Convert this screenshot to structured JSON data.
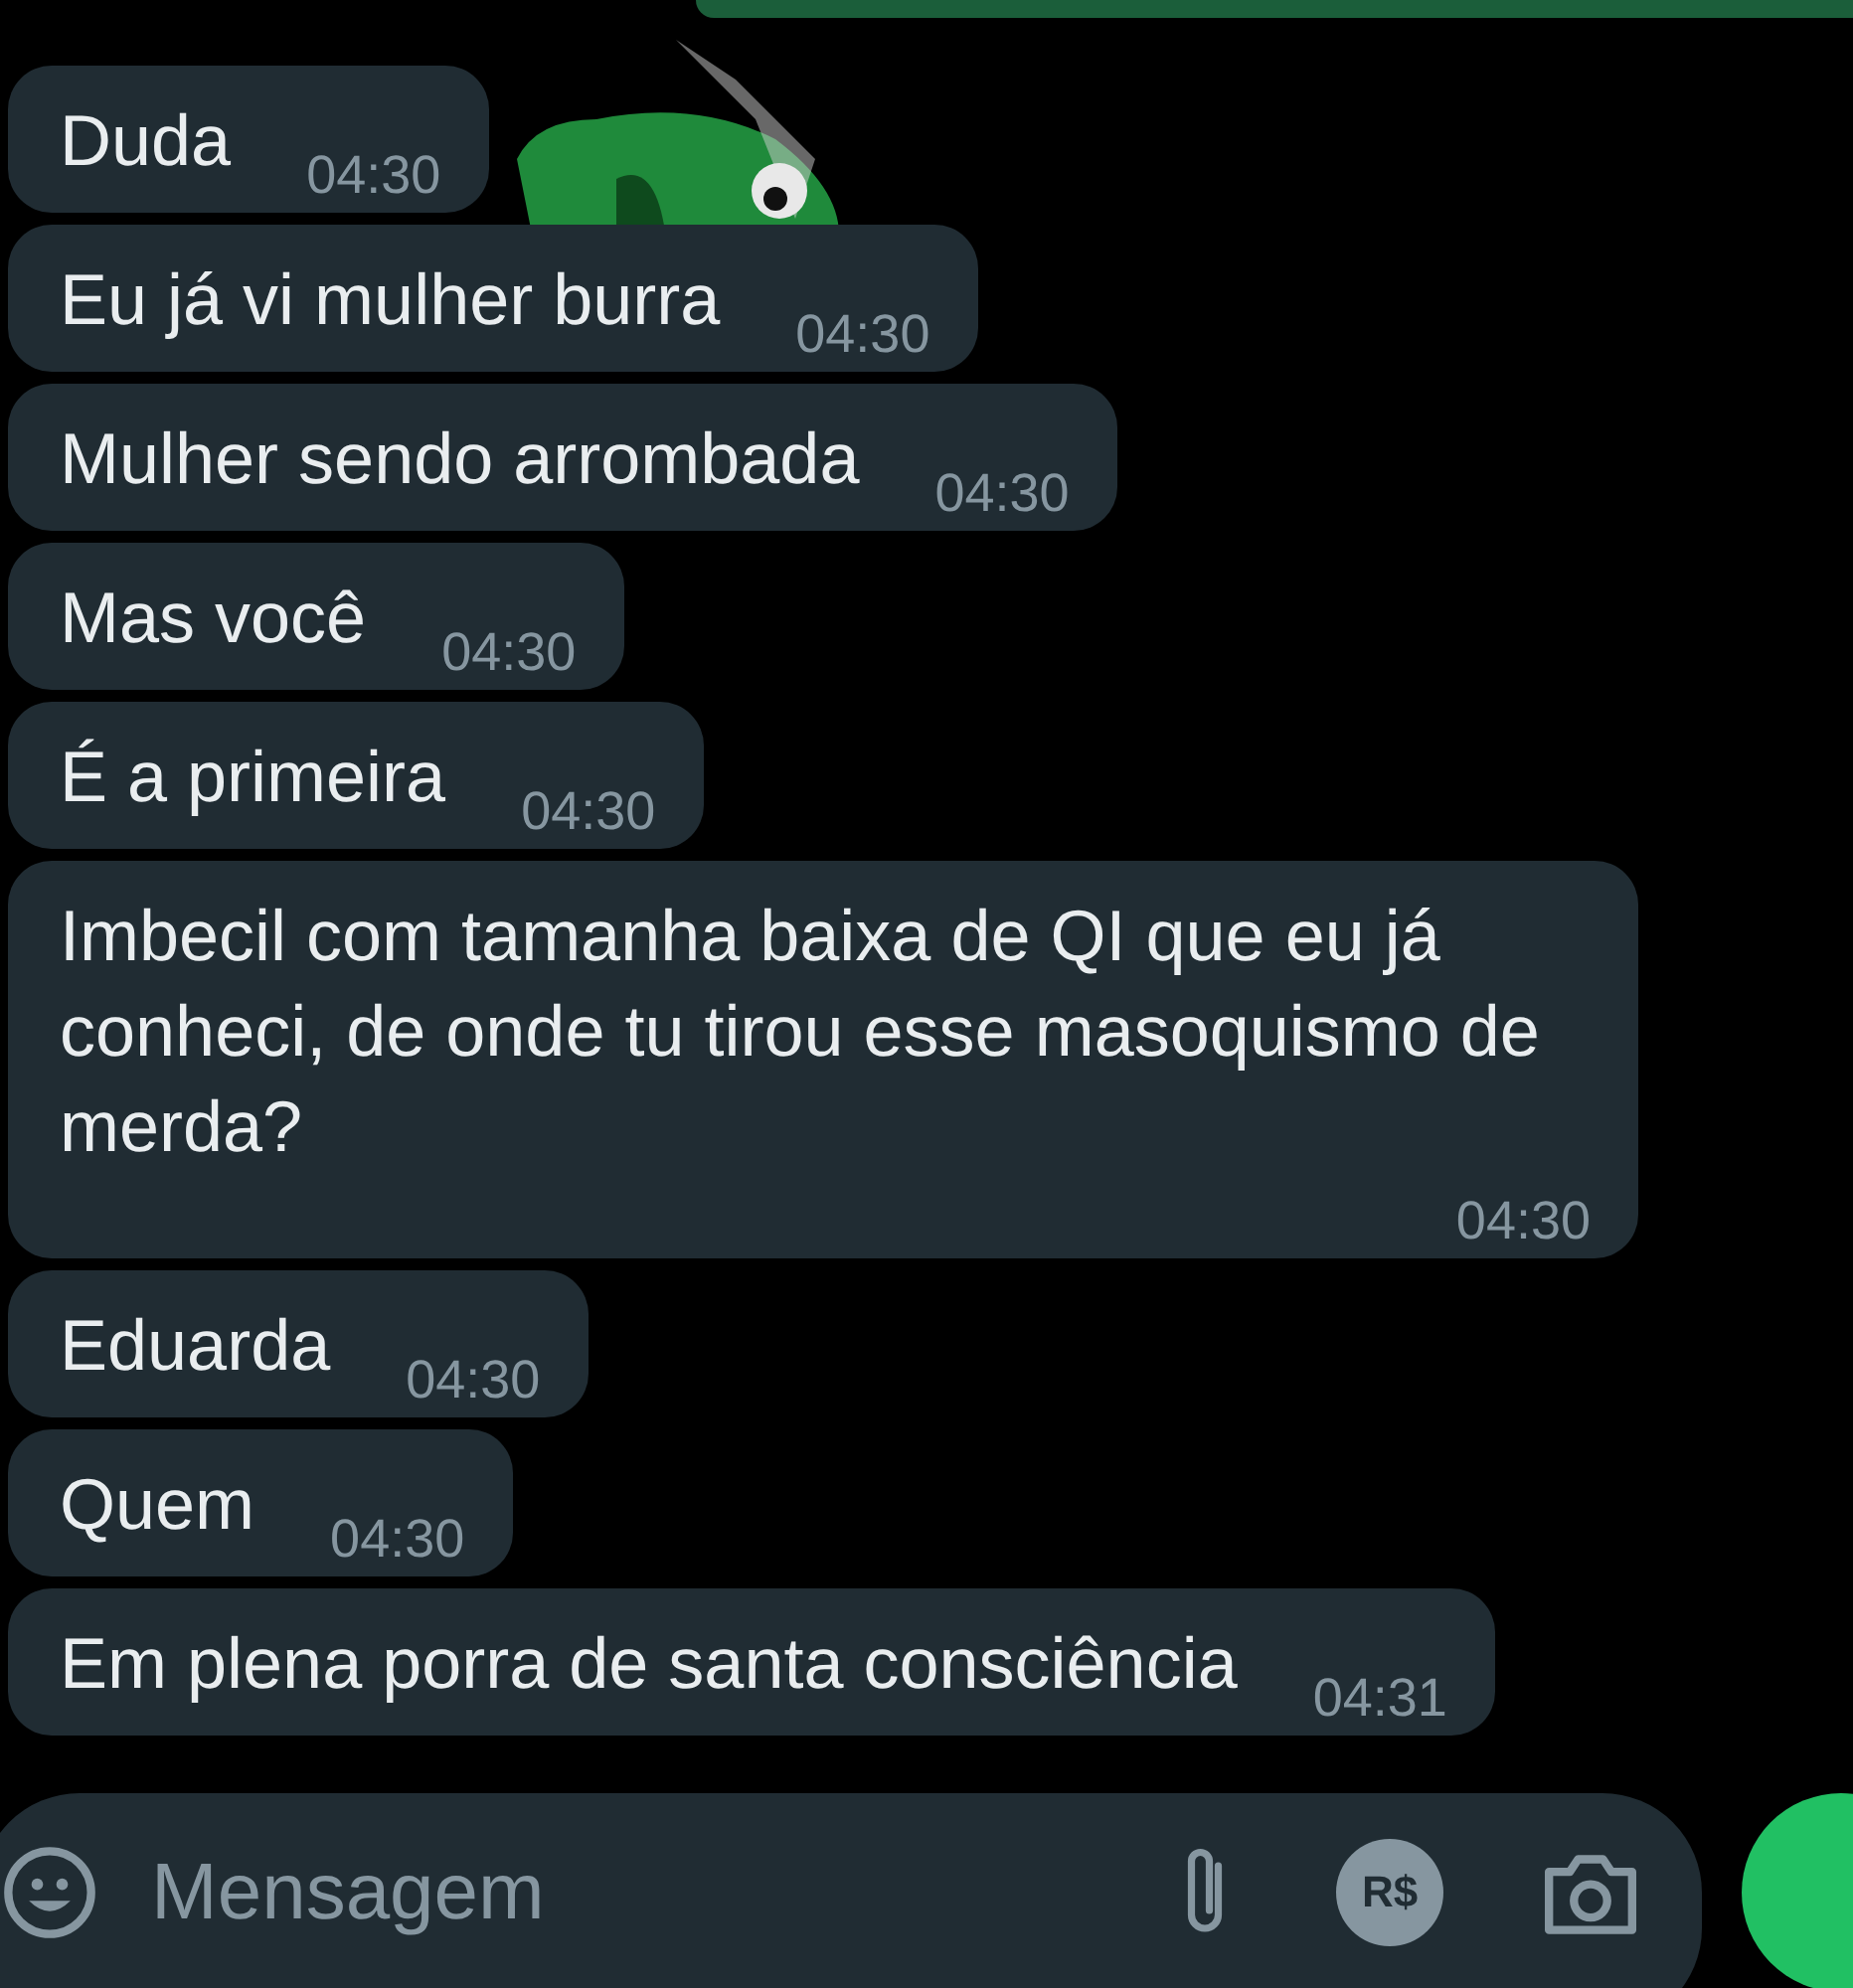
{
  "messages": [
    {
      "text": "Duda",
      "time": "04:30"
    },
    {
      "text": "Eu já vi mulher burra",
      "time": "04:30"
    },
    {
      "text": "Mulher sendo arrombada",
      "time": "04:30"
    },
    {
      "text": "Mas você",
      "time": "04:30"
    },
    {
      "text": "É a primeira",
      "time": "04:30"
    },
    {
      "text": "Imbecil com tamanha baixa de QI que eu já conheci, de onde tu tirou esse masoquismo de merda?",
      "time": "04:30"
    },
    {
      "text": "Eduarda",
      "time": "04:30"
    },
    {
      "text": "Quem",
      "time": "04:30"
    },
    {
      "text": "Em plena porra de santa consciência",
      "time": "04:31"
    }
  ],
  "composer": {
    "placeholder": "Mensagem",
    "payment_label": "R$"
  }
}
